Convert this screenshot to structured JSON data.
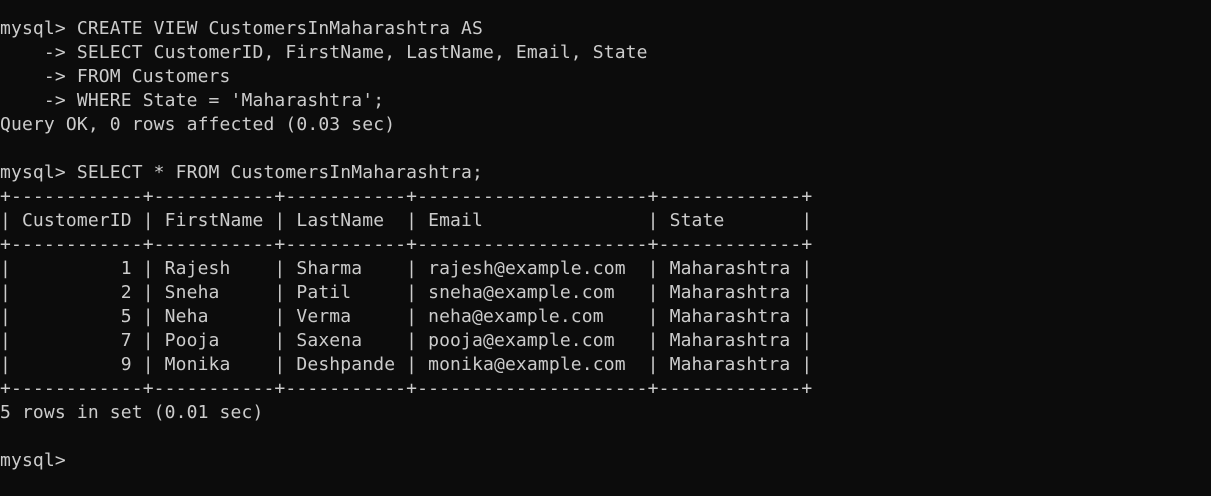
{
  "terminal": {
    "lines": [
      "mysql> CREATE VIEW CustomersInMaharashtra AS",
      "    -> SELECT CustomerID, FirstName, LastName, Email, State",
      "    -> FROM Customers",
      "    -> WHERE State = 'Maharashtra';",
      "Query OK, 0 rows affected (0.03 sec)",
      "",
      "mysql> SELECT * FROM CustomersInMaharashtra;",
      "+------------+-----------+-----------+---------------------+-------------+",
      "| CustomerID | FirstName | LastName  | Email               | State       |",
      "+------------+-----------+-----------+---------------------+-------------+",
      "|          1 | Rajesh    | Sharma    | rajesh@example.com  | Maharashtra |",
      "|          2 | Sneha     | Patil     | sneha@example.com   | Maharashtra |",
      "|          5 | Neha      | Verma     | neha@example.com    | Maharashtra |",
      "|          7 | Pooja     | Saxena    | pooja@example.com   | Maharashtra |",
      "|          9 | Monika    | Deshpande | monika@example.com  | Maharashtra |",
      "+------------+-----------+-----------+---------------------+-------------+",
      "5 rows in set (0.01 sec)",
      "",
      "mysql> "
    ]
  },
  "colors": {
    "background": "#0c0c0c",
    "text": "#cccccc"
  }
}
